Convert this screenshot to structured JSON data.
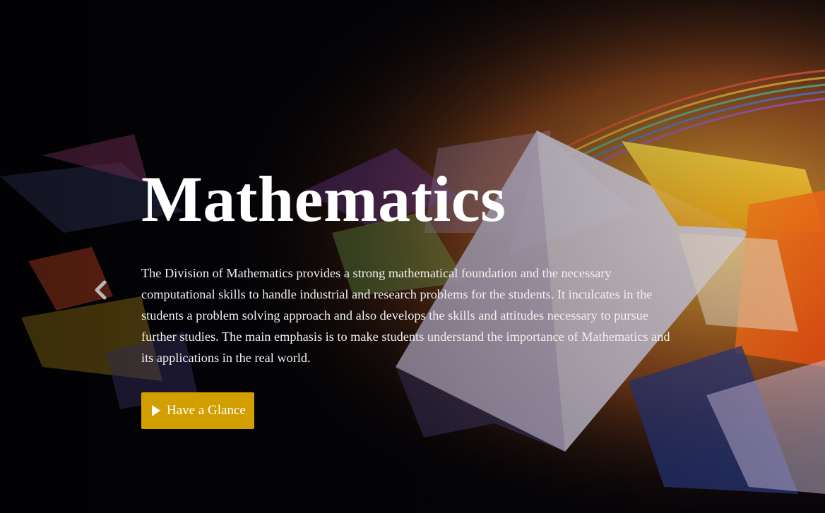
{
  "hero": {
    "title": "Mathematics",
    "description": "The Division of Mathematics provides a strong mathematical foundation and the necessary computational skills to handle industrial and research problems for the students. It inculcates in the students a problem solving approach and also develops the skills and attitudes necessary to pursue further studies. The main emphasis is to make students understand the importance of Mathematics and its applications in the real world.",
    "cta_label": "Have a Glance",
    "cta_icon": "play-icon",
    "prev_icon": "chevron-left-icon"
  },
  "colors": {
    "background": "#05040a",
    "cta_background": "#d39e00",
    "title": "#ffffff",
    "text": "#f0f0f0"
  }
}
